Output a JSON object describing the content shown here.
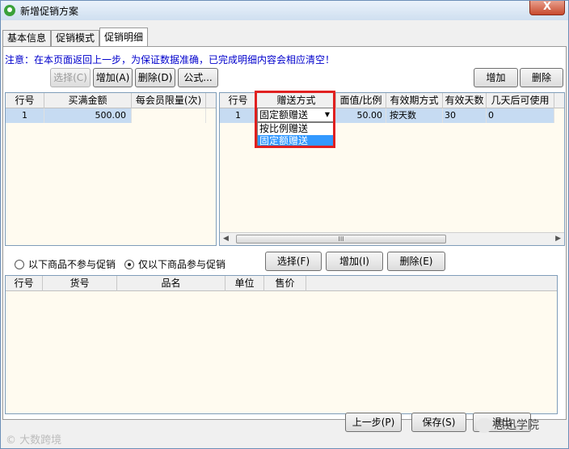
{
  "window": {
    "title": "新增促销方案",
    "close": "X"
  },
  "tabs": [
    "基本信息",
    "促销模式",
    "促销明细"
  ],
  "notice": "注意：在本页面返回上一步，为保证数据准确，已完成明细内容会相应清空！",
  "left_toolbar": {
    "select": "选择(C)",
    "add": "增加(A)",
    "delete": "删除(D)",
    "formula": "公式..."
  },
  "right_toolbar": {
    "add": "增加",
    "delete": "删除"
  },
  "left_grid": {
    "headers": [
      "行号",
      "买满金额",
      "每会员限量(次)"
    ],
    "rows": [
      [
        "1",
        "500.00",
        ""
      ]
    ]
  },
  "right_grid": {
    "headers": [
      "行号",
      "赠送方式",
      "面值/比例",
      "有效期方式",
      "有效天数",
      "几天后可使用"
    ],
    "rows": [
      [
        "1",
        "固定额赠送",
        "50.00",
        "按天数",
        "30",
        "0"
      ]
    ],
    "dropdown_options": [
      "按比例赠送",
      "固定额赠送"
    ],
    "selected_option": "固定额赠送",
    "scroll_grip": "III"
  },
  "goods_filter": {
    "options": [
      "以下商品不参与促销",
      "仅以下商品参与促销"
    ],
    "selected": "仅以下商品参与促销",
    "select": "选择(F)",
    "add": "增加(I)",
    "delete": "删除(E)"
  },
  "bottom_grid": {
    "headers": [
      "行号",
      "货号",
      "品名",
      "单位",
      "售价"
    ]
  },
  "footer": {
    "prev": "上一步(P)",
    "save": "保存(S)",
    "exit": "退出"
  },
  "watermarks": {
    "left": "大数跨境",
    "right": "思迅学院"
  }
}
